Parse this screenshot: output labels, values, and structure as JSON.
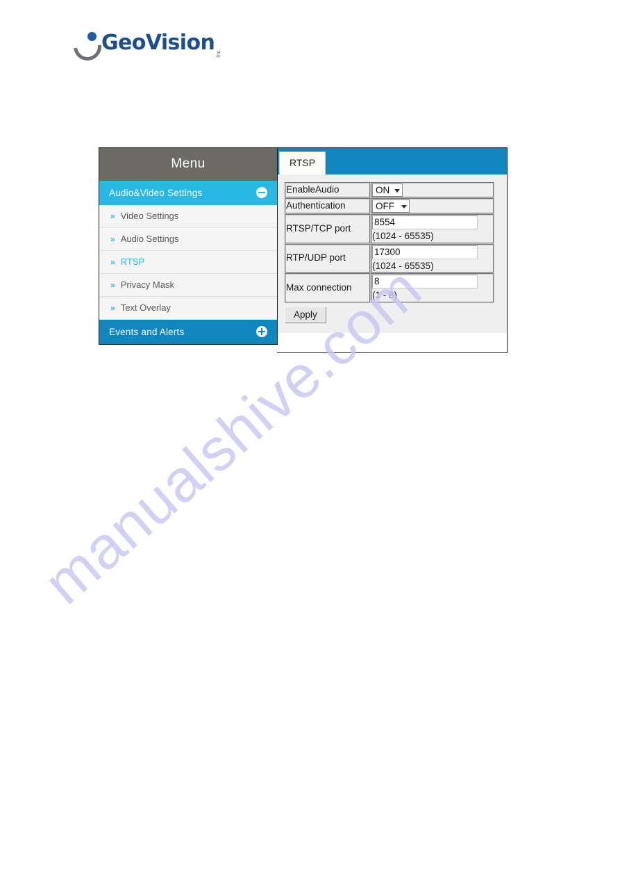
{
  "brand": {
    "name": "GeoVision",
    "suffix": "Inc.",
    "logo_icon": "geovision-crescent-icon",
    "primary_color": "#1d4f8c"
  },
  "watermark": {
    "text": "manualshive.com",
    "color": "#c9c7f2"
  },
  "camera_ui": {
    "sidebar": {
      "header": "Menu",
      "header_color": "#6b6b64",
      "sections": [
        {
          "label": "Audio&Video Settings",
          "state": "expanded",
          "toggle_icon": "minus-circle-icon",
          "color": "#27b9e4",
          "items": [
            {
              "label": "Video Settings",
              "active": false
            },
            {
              "label": "Audio Settings",
              "active": false
            },
            {
              "label": "RTSP",
              "active": true
            },
            {
              "label": "Privacy Mask",
              "active": false
            },
            {
              "label": "Text Overlay",
              "active": false
            }
          ]
        },
        {
          "label": "Events and Alerts",
          "state": "collapsed",
          "toggle_icon": "plus-circle-icon",
          "color": "#0f86bd",
          "items": []
        }
      ],
      "bullet_icon": "double-chevron-right-icon"
    },
    "content": {
      "tabs": [
        {
          "label": "RTSP",
          "active": true
        }
      ],
      "tabstrip_color": "#0f86bd",
      "form": {
        "rows": [
          {
            "label": "EnableAudio",
            "control": "select",
            "value": "ON",
            "hint": ""
          },
          {
            "label": "Authentication",
            "control": "select",
            "value": "OFF",
            "hint": ""
          },
          {
            "label": "RTSP/TCP port",
            "control": "text",
            "value": "8554",
            "hint": "(1024 - 65535)"
          },
          {
            "label": "RTP/UDP port",
            "control": "text",
            "value": "17300",
            "hint": "(1024 - 65535)"
          },
          {
            "label": "Max connection",
            "control": "text",
            "value": "8",
            "hint": "(1 - 8)"
          }
        ],
        "apply_label": "Apply"
      }
    }
  }
}
